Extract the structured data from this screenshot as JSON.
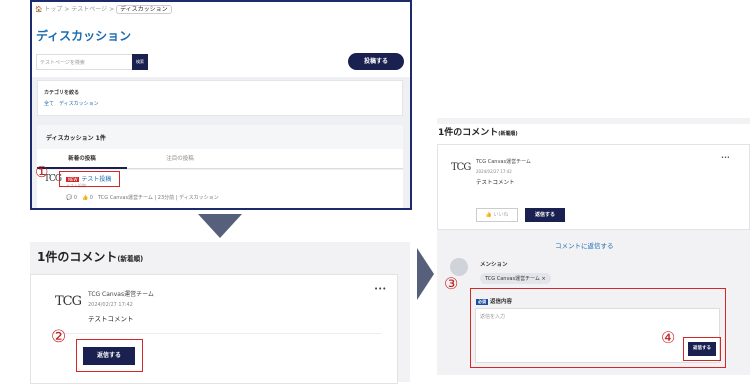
{
  "panel1": {
    "breadcrumb": {
      "home": "トップ",
      "sep": ">",
      "item2": "テストページ",
      "current": "ディスカッション"
    },
    "title": "ディスカッション",
    "search": {
      "placeholder": "テストページを検索",
      "button": "検索"
    },
    "post_button": "投稿する",
    "category": {
      "heading": "カテゴリを絞る",
      "links": "全て　ディスカッション"
    },
    "count_label": "ディスカッション 1件",
    "tabs": [
      "新着の投稿",
      "注目の投稿"
    ],
    "item": {
      "badge": "NEW",
      "title": "テスト投稿",
      "sub": "テスト投稿",
      "meta": "💬 0　👍 0　TCG Canvas運営チーム | 23分前 | ディスカッション"
    }
  },
  "marker_1": "①",
  "marker_2": "②",
  "marker_3": "③",
  "marker_4": "④",
  "logo": "TCG",
  "panel2": {
    "title": "1件のコメント",
    "sort": "(新着順)",
    "author": "TCG Canvas運営チーム",
    "date": "2024/02/27 17:42",
    "comment": "テストコメント",
    "more": "•••",
    "reply_button": "返信する"
  },
  "panel3": {
    "title": "1件のコメント",
    "sort": "(新着順)",
    "author": "TCG Canvas運営チーム",
    "date": "2024/02/27 17:42",
    "comment": "テストコメント",
    "more": "•••",
    "like_button": "👍 いいね",
    "reply_button": "返信する",
    "reply_heading": "コメントに返信する",
    "mention_label": "メンション",
    "mention_chip": "TCG Canvas運営チーム ×",
    "required_badge": "必須",
    "content_label": "返信内容",
    "textarea_placeholder": "返信を入力",
    "submit_button": "返信する"
  }
}
